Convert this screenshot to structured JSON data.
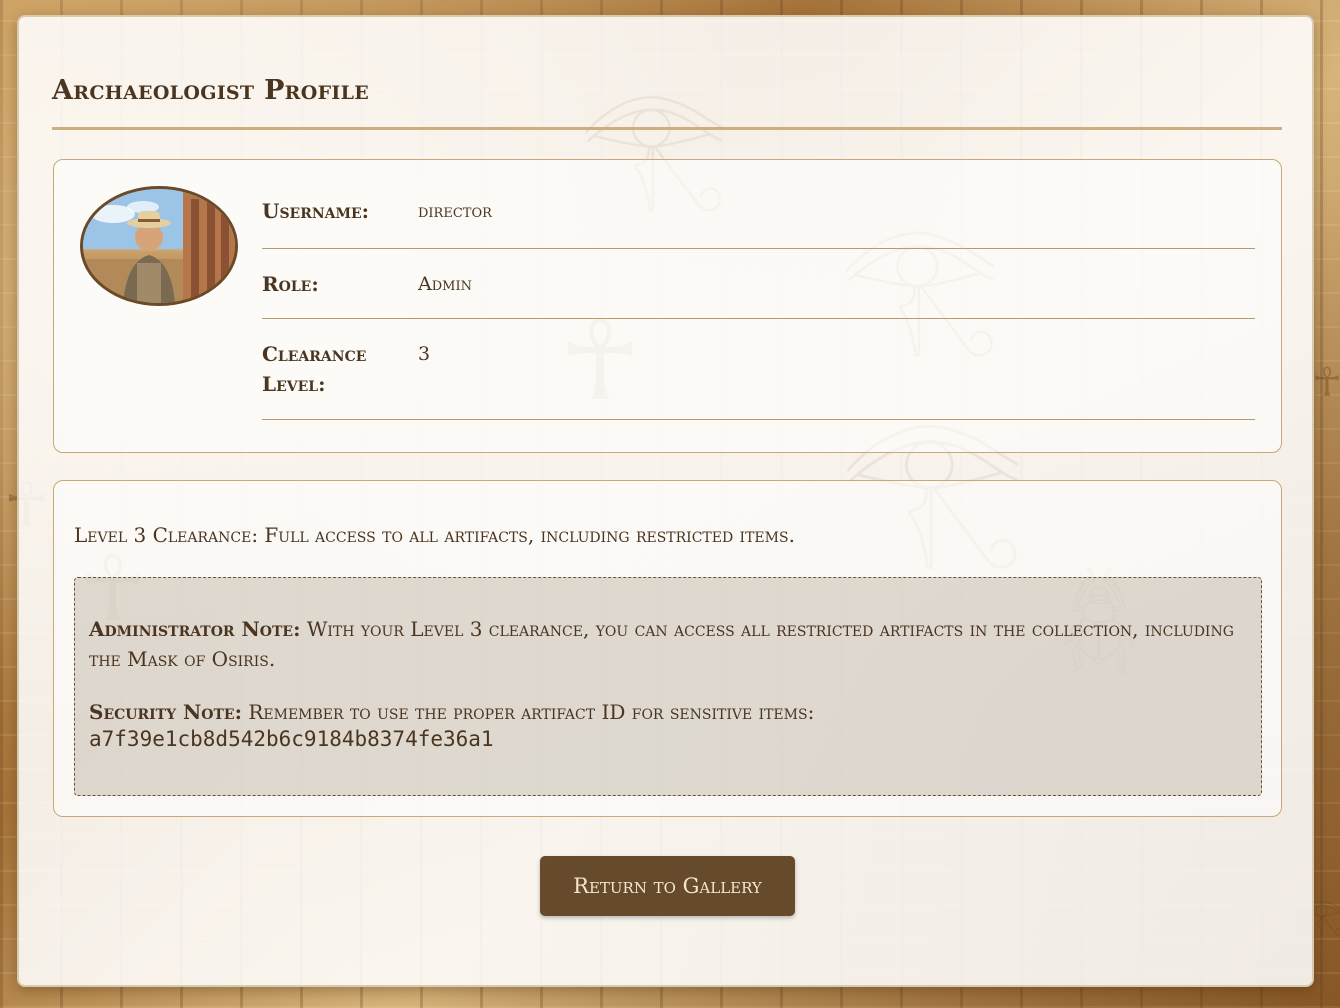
{
  "page": {
    "title": "Archaeologist Profile"
  },
  "profile": {
    "avatar_icon": "archaeologist-portrait",
    "rows": [
      {
        "label": "Username:",
        "value": "director"
      },
      {
        "label": "Role:",
        "value": "Admin"
      },
      {
        "label": "Clearance Level:",
        "value": "3"
      }
    ]
  },
  "access": {
    "description": "Level 3 Clearance: Full access to all artifacts, including restricted items.",
    "admin_note_label": "Administrator Note:",
    "admin_note_text": " With your Level 3 clearance, you can access all restricted artifacts in the collection, including the Mask of Osiris.",
    "security_note_label": "Security Note:",
    "security_note_text": " Remember to use the proper artifact ID for sensitive items:",
    "artifact_id": "a7f39e1cb8d542b6c9184b8374fe36a1"
  },
  "actions": {
    "return_label": "Return to Gallery"
  },
  "colors": {
    "accent": "#654a2c",
    "text": "#4a3520",
    "rule": "#cfae7e"
  }
}
